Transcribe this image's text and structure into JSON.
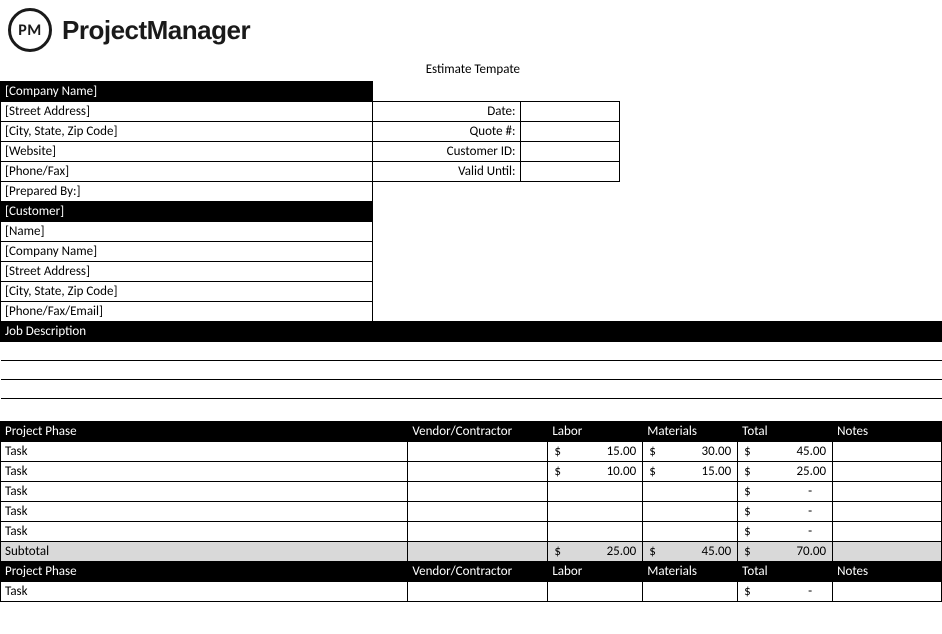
{
  "brand": {
    "abbr": "PM",
    "name": "ProjectManager"
  },
  "title": "Estimate Tempate",
  "company_header": "[Company Name]",
  "company_fields": {
    "street": "[Street Address]",
    "csz": "[City, State, Zip Code]",
    "website": "[Website]",
    "phonefax": "[Phone/Fax]",
    "preparedby": "[Prepared By:]"
  },
  "meta_labels": {
    "date": "Date:",
    "quote": "Quote #:",
    "customer_id": "Customer ID:",
    "valid_until": "Valid Until:"
  },
  "meta_values": {
    "date": "",
    "quote": "",
    "customer_id": "",
    "valid_until": ""
  },
  "customer_header": "[Customer]",
  "customer_fields": {
    "name": "[Name]",
    "company": "[Company Name]",
    "street": "[Street Address]",
    "csz": "[City, State, Zip Code]",
    "contact": "[Phone/Fax/Email]"
  },
  "jobdesc_header": "Job Description",
  "jobdesc_lines": [
    "",
    "",
    ""
  ],
  "table_headers": {
    "phase": "Project Phase",
    "vendor": "Vendor/Contractor",
    "labor": "Labor",
    "materials": "Materials",
    "total": "Total",
    "notes": "Notes"
  },
  "phase1": {
    "rows": [
      {
        "task": "Task",
        "vendor": "",
        "labor": "15.00",
        "materials": "30.00",
        "total": "45.00",
        "notes": ""
      },
      {
        "task": "Task",
        "vendor": "",
        "labor": "10.00",
        "materials": "15.00",
        "total": "25.00",
        "notes": ""
      },
      {
        "task": "Task",
        "vendor": "",
        "labor": "",
        "materials": "",
        "total": "-",
        "notes": ""
      },
      {
        "task": "Task",
        "vendor": "",
        "labor": "",
        "materials": "",
        "total": "-",
        "notes": ""
      },
      {
        "task": "Task",
        "vendor": "",
        "labor": "",
        "materials": "",
        "total": "-",
        "notes": ""
      }
    ],
    "subtotal": {
      "label": "Subtotal",
      "labor": "25.00",
      "materials": "45.00",
      "total": "70.00"
    }
  },
  "phase2": {
    "rows": [
      {
        "task": "Task",
        "vendor": "",
        "labor": "",
        "materials": "",
        "total": "-",
        "notes": ""
      }
    ]
  },
  "currency_symbol": "$"
}
